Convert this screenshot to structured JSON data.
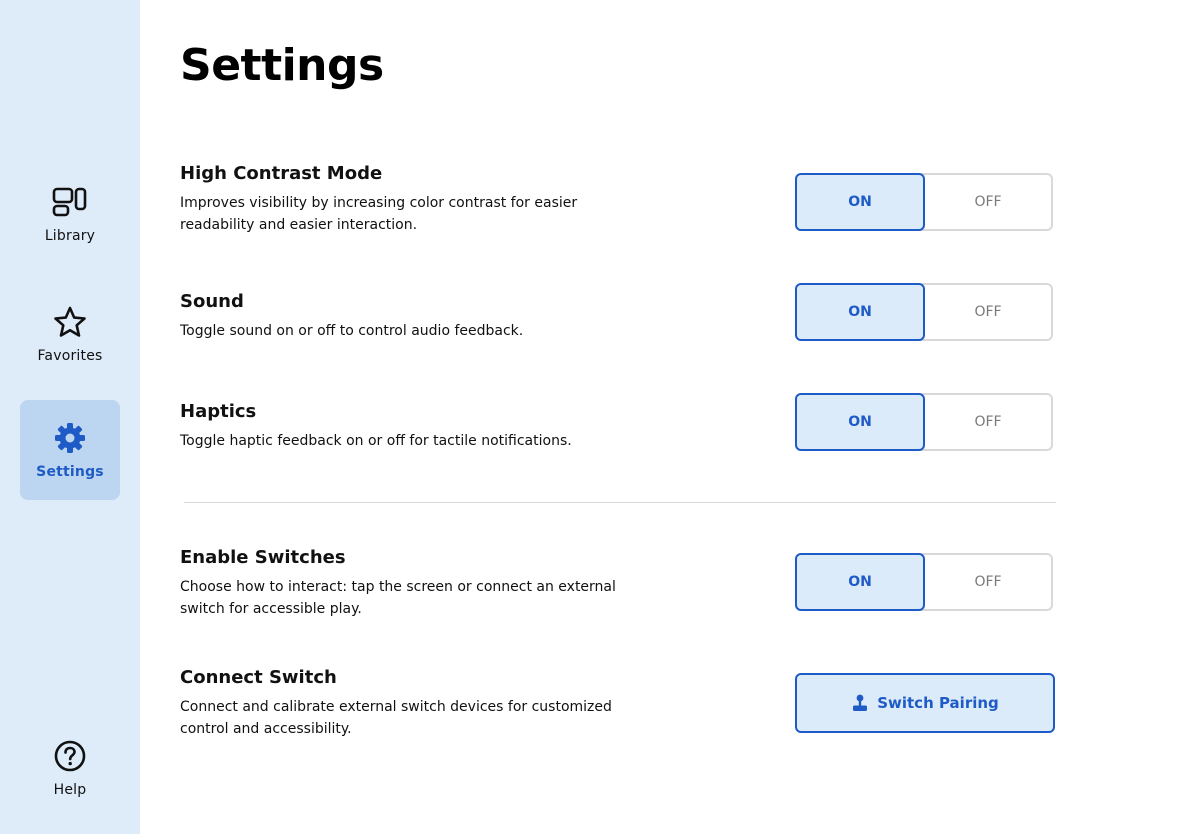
{
  "colors": {
    "sidebar_bg": "#deebf8",
    "active_bg": "#bcd5f0",
    "accent": "#1f5bc6",
    "toggle_on_bg": "#dcebf9",
    "toggle_border": "#d9d9d9"
  },
  "sidebar": {
    "items": [
      {
        "label": "Library",
        "icon": "library-icon",
        "active": false
      },
      {
        "label": "Favorites",
        "icon": "star-icon",
        "active": false
      },
      {
        "label": "Settings",
        "icon": "gear-icon",
        "active": true
      },
      {
        "label": "Help",
        "icon": "help-icon",
        "active": false
      }
    ]
  },
  "page": {
    "title": "Settings"
  },
  "settings": [
    {
      "title": "High Contrast Mode",
      "description": "Improves visibility by increasing color contrast for easier readability and easier interaction.",
      "on_label": "ON",
      "off_label": "OFF",
      "value": "ON"
    },
    {
      "title": "Sound",
      "description": "Toggle sound on or off to control audio feedback.",
      "on_label": "ON",
      "off_label": "OFF",
      "value": "ON"
    },
    {
      "title": "Haptics",
      "description": "Toggle haptic feedback on or off for tactile notifications.",
      "on_label": "ON",
      "off_label": "OFF",
      "value": "ON"
    },
    {
      "title": "Enable Switches",
      "description": "Choose how to interact: tap the screen or connect an external switch for accessible play.",
      "on_label": "ON",
      "off_label": "OFF",
      "value": "ON"
    }
  ],
  "connect_switch": {
    "title": "Connect Switch",
    "description": "Connect and calibrate external switch devices for customized control and accessibility.",
    "button_label": "Switch Pairing",
    "button_icon": "joystick-icon"
  }
}
